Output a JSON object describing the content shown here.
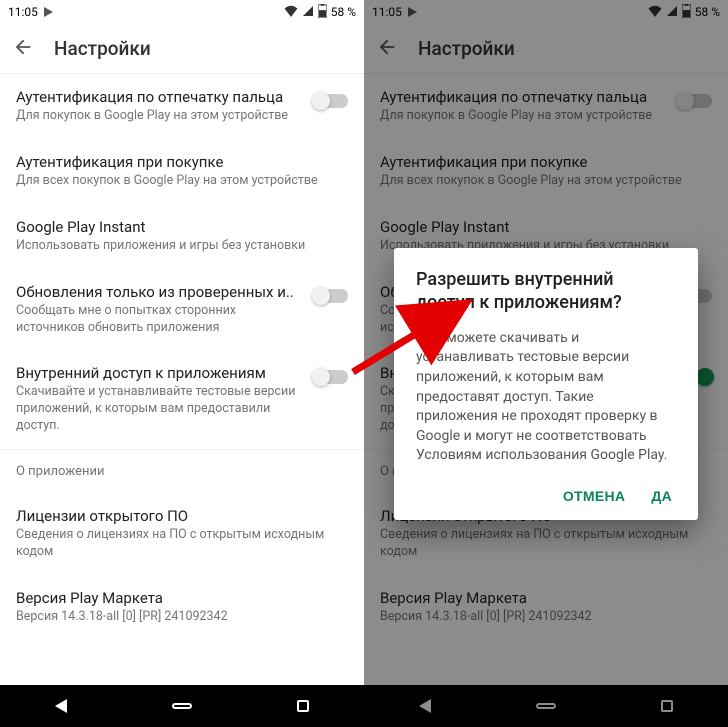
{
  "status": {
    "time": "11:05",
    "battery": "58 %"
  },
  "appbar": {
    "title": "Настройки"
  },
  "settings": {
    "fingerprint": {
      "title": "Аутентификация по отпечатку пальца",
      "subtitle": "Для покупок в Google Play на этом устройстве"
    },
    "purchase": {
      "title": "Аутентификация при покупке",
      "subtitle": "Для всех покупок в Google Play на этом устройстве"
    },
    "instant": {
      "title": "Google Play Instant",
      "subtitle": "Использовать приложения и игры без установки"
    },
    "verified": {
      "title": "Обновления только из проверенных и..",
      "subtitle": "Сообщать мне о попытках сторонних источников обновить приложения"
    },
    "internal": {
      "title": "Внутренний доступ к приложениям",
      "subtitle": "Скачивайте и устанавливайте тестовые версии приложений, к которым вам предоставили доступ."
    }
  },
  "about": {
    "header": "О приложении",
    "license": {
      "title": "Лицензии открытого ПО",
      "subtitle": "Сведения о лицензиях на ПО с открытым исходным кодом"
    },
    "version": {
      "title": "Версия Play Маркета",
      "subtitle": "Версия 14.3.18-all [0] [PR] 241092342"
    }
  },
  "dialog": {
    "title": "Разрешить внутренний доступ к приложениям?",
    "body": "Вы сможете скачивать и устанавливать тестовые версии приложений, к которым вам предоставят доступ. Такие приложения не проходят проверку в Google и могут не соответствовать Условиям использования Google Play.",
    "cancel": "ОТМЕНА",
    "ok": "ДА"
  }
}
